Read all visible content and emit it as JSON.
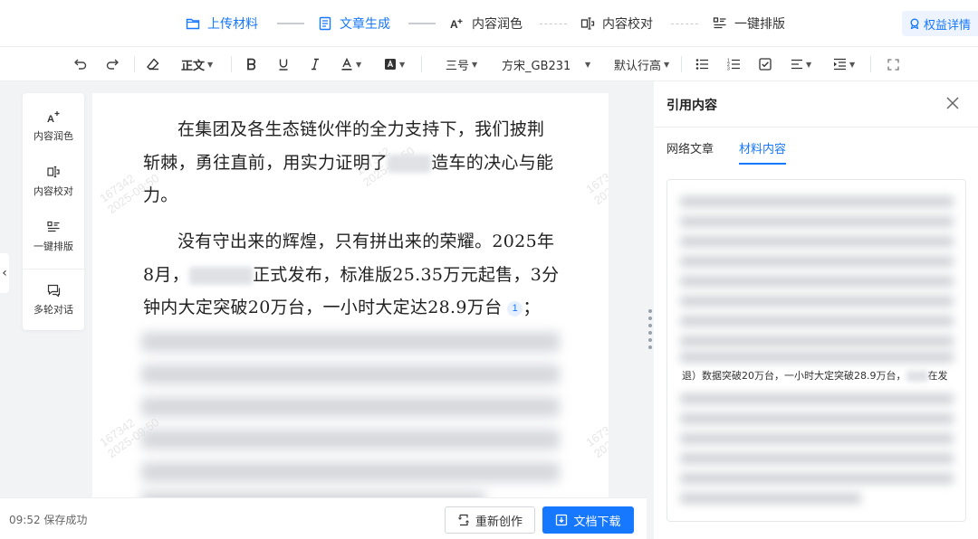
{
  "steps": [
    {
      "label": "上传材料",
      "active": true,
      "icon": "folder-icon"
    },
    {
      "label": "文章生成",
      "active": true,
      "icon": "document-icon"
    },
    {
      "label": "内容润色",
      "active": false,
      "icon": "text-polish-icon"
    },
    {
      "label": "内容校对",
      "active": false,
      "icon": "proofread-icon"
    },
    {
      "label": "一键排版",
      "active": false,
      "icon": "layout-icon"
    }
  ],
  "rights_label": "权益详情",
  "toolbar": {
    "style": "正文",
    "font_size": "三号",
    "font_family": "方宋_GB2312",
    "line_height": "默认行高"
  },
  "side_tools": [
    {
      "label": "内容润色",
      "icon": "text-polish-icon"
    },
    {
      "label": "内容校对",
      "icon": "proofread-icon"
    },
    {
      "label": "一键排版",
      "icon": "layout-icon"
    },
    {
      "label": "多轮对话",
      "icon": "chat-icon"
    }
  ],
  "article": {
    "p1_a": "在集团及各生态链伙伴的全力支持下，我们披荆斩棘，勇往直前，用实力证明了",
    "p1_b": "造车的决心与能力。",
    "p2_a": "没有守出来的辉煌，只有拼出来的荣耀。2025年8月，",
    "p2_b": "正式发布，标准版25.35万元起售，3分钟内大定突破20万台，一小时大定达28.9万台",
    "p2_ref": "1",
    "p2_c": "；"
  },
  "watermark": {
    "line1": "167342",
    "line2": "2025-09:50"
  },
  "bottom": {
    "save_status": "09:52 保存成功",
    "regen_label": "重新创作",
    "download_label": "文档下载"
  },
  "panel": {
    "title": "引用内容",
    "tabs": [
      {
        "label": "网络文章",
        "active": false
      },
      {
        "label": "材料内容",
        "active": true
      }
    ],
    "visible_line_a": "退）数据突破20万台，一小时大定突破28.9万台，",
    "visible_line_b": "在发"
  },
  "colors": {
    "accent": "#1677ff",
    "background": "#f2f3f5"
  }
}
